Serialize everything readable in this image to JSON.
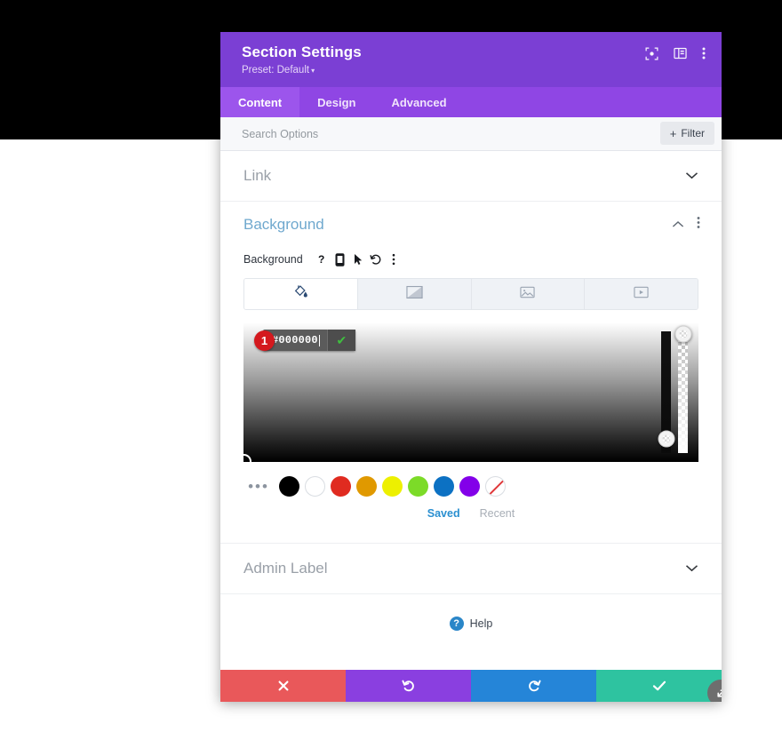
{
  "header": {
    "title": "Section Settings",
    "preset": "Preset: Default",
    "preset_caret": "▾",
    "icons": [
      "focus-target-icon",
      "panel-layout-icon",
      "more-vertical-icon"
    ]
  },
  "tabs": [
    {
      "label": "Content",
      "active": true
    },
    {
      "label": "Design",
      "active": false
    },
    {
      "label": "Advanced",
      "active": false
    }
  ],
  "search": {
    "placeholder": "Search Options",
    "value": "",
    "filter_label": "Filter",
    "filter_plus": "+"
  },
  "sections": {
    "link": {
      "title": "Link",
      "chevron": "⌄"
    },
    "background": {
      "title": "Background",
      "collapse_chevron": "⌃",
      "menu_dots": "⋮",
      "field_label": "Background",
      "field_icons": [
        "help-question-icon",
        "responsive-mobile-icon",
        "hover-cursor-icon",
        "reset-undo-icon",
        "more-vertical-icon"
      ],
      "type_tabs": [
        {
          "name": "background-color",
          "icon": "paint-bucket-icon",
          "active": true
        },
        {
          "name": "background-gradient",
          "icon": "gradient-icon",
          "active": false
        },
        {
          "name": "background-image",
          "icon": "image-icon",
          "active": false
        },
        {
          "name": "background-video",
          "icon": "video-icon",
          "active": false
        }
      ],
      "color_picker": {
        "hex_value": "#000000",
        "confirm_icon": "check-icon",
        "step_badge": "1",
        "hue_slider_position_pct": 88,
        "alpha_slider_position_pct": 2
      },
      "swatches": [
        {
          "name": "more-swatches",
          "color": ""
        },
        {
          "name": "swatch-black",
          "color": "#000000"
        },
        {
          "name": "swatch-white",
          "color": "#FFFFFF"
        },
        {
          "name": "swatch-red",
          "color": "#E02B20"
        },
        {
          "name": "swatch-orange",
          "color": "#E09900"
        },
        {
          "name": "swatch-yellow",
          "color": "#EDF000"
        },
        {
          "name": "swatch-green",
          "color": "#7CDB28"
        },
        {
          "name": "swatch-blue",
          "color": "#0C71C3"
        },
        {
          "name": "swatch-purple",
          "color": "#8300E9"
        },
        {
          "name": "swatch-transparent",
          "color": ""
        }
      ],
      "more_dots": "•••",
      "swatch_tabs": [
        {
          "label": "Saved",
          "active": true
        },
        {
          "label": "Recent",
          "active": false
        }
      ]
    },
    "admin_label": {
      "title": "Admin Label",
      "chevron": "⌄"
    }
  },
  "help": {
    "label": "Help",
    "icon_glyph": "?"
  },
  "footer": {
    "buttons": [
      {
        "name": "close-button",
        "icon": "x-icon",
        "glyph": "✖",
        "color": "#E9585A"
      },
      {
        "name": "undo-button",
        "icon": "undo-icon",
        "glyph": "↺",
        "color": "#8A3FE0"
      },
      {
        "name": "redo-button",
        "icon": "redo-icon",
        "glyph": "↻",
        "color": "#2585D8"
      },
      {
        "name": "save-button",
        "icon": "check-icon",
        "glyph": "✔",
        "color": "#2EC3A0"
      }
    ],
    "resize_handle": "resize-handle-icon"
  },
  "colors": {
    "header_purple": "#7B3FD4",
    "tabs_purple": "#8F46E4",
    "tab_active_purple": "#9C55EC",
    "accent_blue": "#2A8FD0",
    "section_title_blue": "#6FA8CE"
  }
}
